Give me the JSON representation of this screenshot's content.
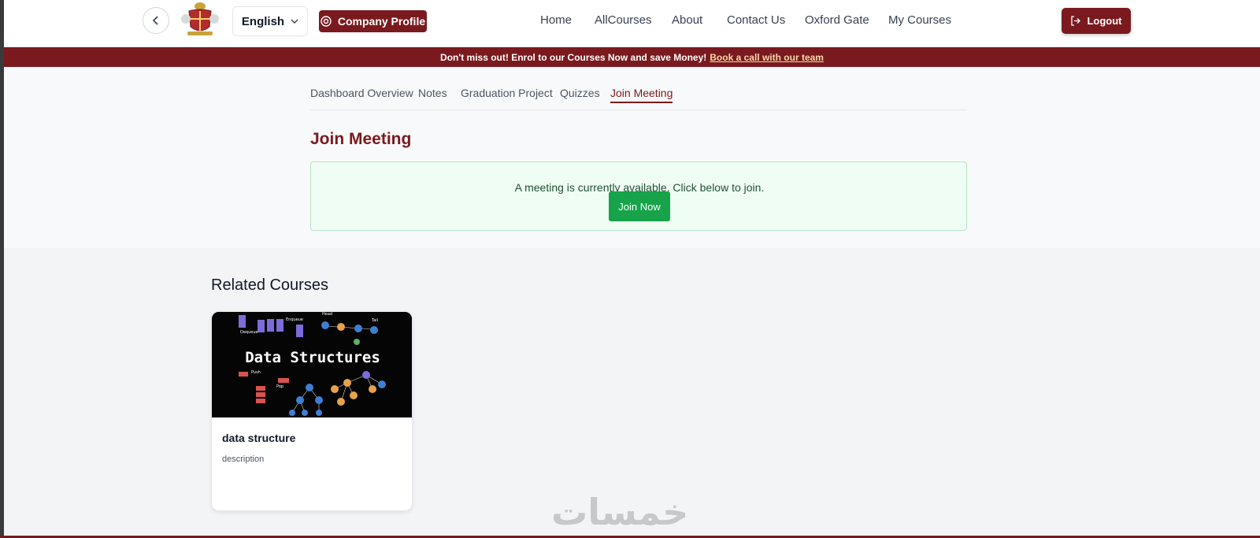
{
  "header": {
    "language": "English",
    "company_profile": "Company Profile",
    "nav": [
      "Home",
      "AllCourses",
      "About",
      "Contact Us",
      "Oxford Gate",
      "My Courses"
    ],
    "logout": "Logout"
  },
  "promo": {
    "text": "Don't miss out! Enrol to our Courses Now and save Money!",
    "link": "Book a call with our team"
  },
  "dashboard": {
    "tabs": [
      "Dashboard Overview",
      "Notes",
      "Graduation Project",
      "Quizzes",
      "Join Meeting"
    ],
    "active_tab": "Join Meeting",
    "section_title": "Join Meeting",
    "meeting_message": "A meeting is currently available. Click below to join.",
    "join_button": "Join Now"
  },
  "related": {
    "title": "Related Courses",
    "courses": [
      {
        "name": "data structure",
        "description": "description",
        "thumb_title": "Data Structures",
        "thumb_labels": [
          "Dequeue",
          "Enqueue",
          "Head",
          "Tail",
          "Push",
          "Pop"
        ]
      }
    ]
  },
  "watermark": "خمسات",
  "colors": {
    "brand": "#7a1a1f",
    "success": "#16a34a",
    "success_bg": "#f0fdf4"
  }
}
